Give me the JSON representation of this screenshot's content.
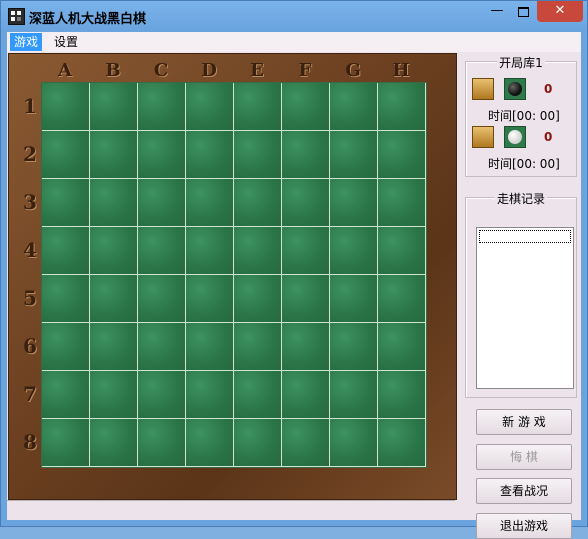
{
  "window": {
    "title": "深蓝人机大战黑白棋"
  },
  "title_buttons": {
    "minimize": "—",
    "close": "✕"
  },
  "menu": {
    "items": [
      "游戏",
      "设置"
    ],
    "active_index": 0
  },
  "board": {
    "columns": [
      "A",
      "B",
      "C",
      "D",
      "E",
      "F",
      "G",
      "H"
    ],
    "rows": [
      "1",
      "2",
      "3",
      "4",
      "5",
      "6",
      "7",
      "8"
    ]
  },
  "sidebar": {
    "opening_group_title": "开局库1",
    "black_player": {
      "score": "0",
      "timer": "时间[00: 00]",
      "piece": "black-stone"
    },
    "white_player": {
      "score": "0",
      "timer": "时间[00: 00]",
      "piece": "white-stone"
    },
    "record_group_title": "走棋记录",
    "buttons": {
      "new_game": "新 游 戏",
      "undo": "悔    棋",
      "view_status": "查看战况",
      "exit_game": "退出游戏"
    }
  },
  "colors": {
    "board_green": "#2f7a4a",
    "frame_wood": "#6e4222",
    "title_bar": "#6aa4df",
    "close_red": "#c9483c",
    "score_red": "#8a1010"
  }
}
